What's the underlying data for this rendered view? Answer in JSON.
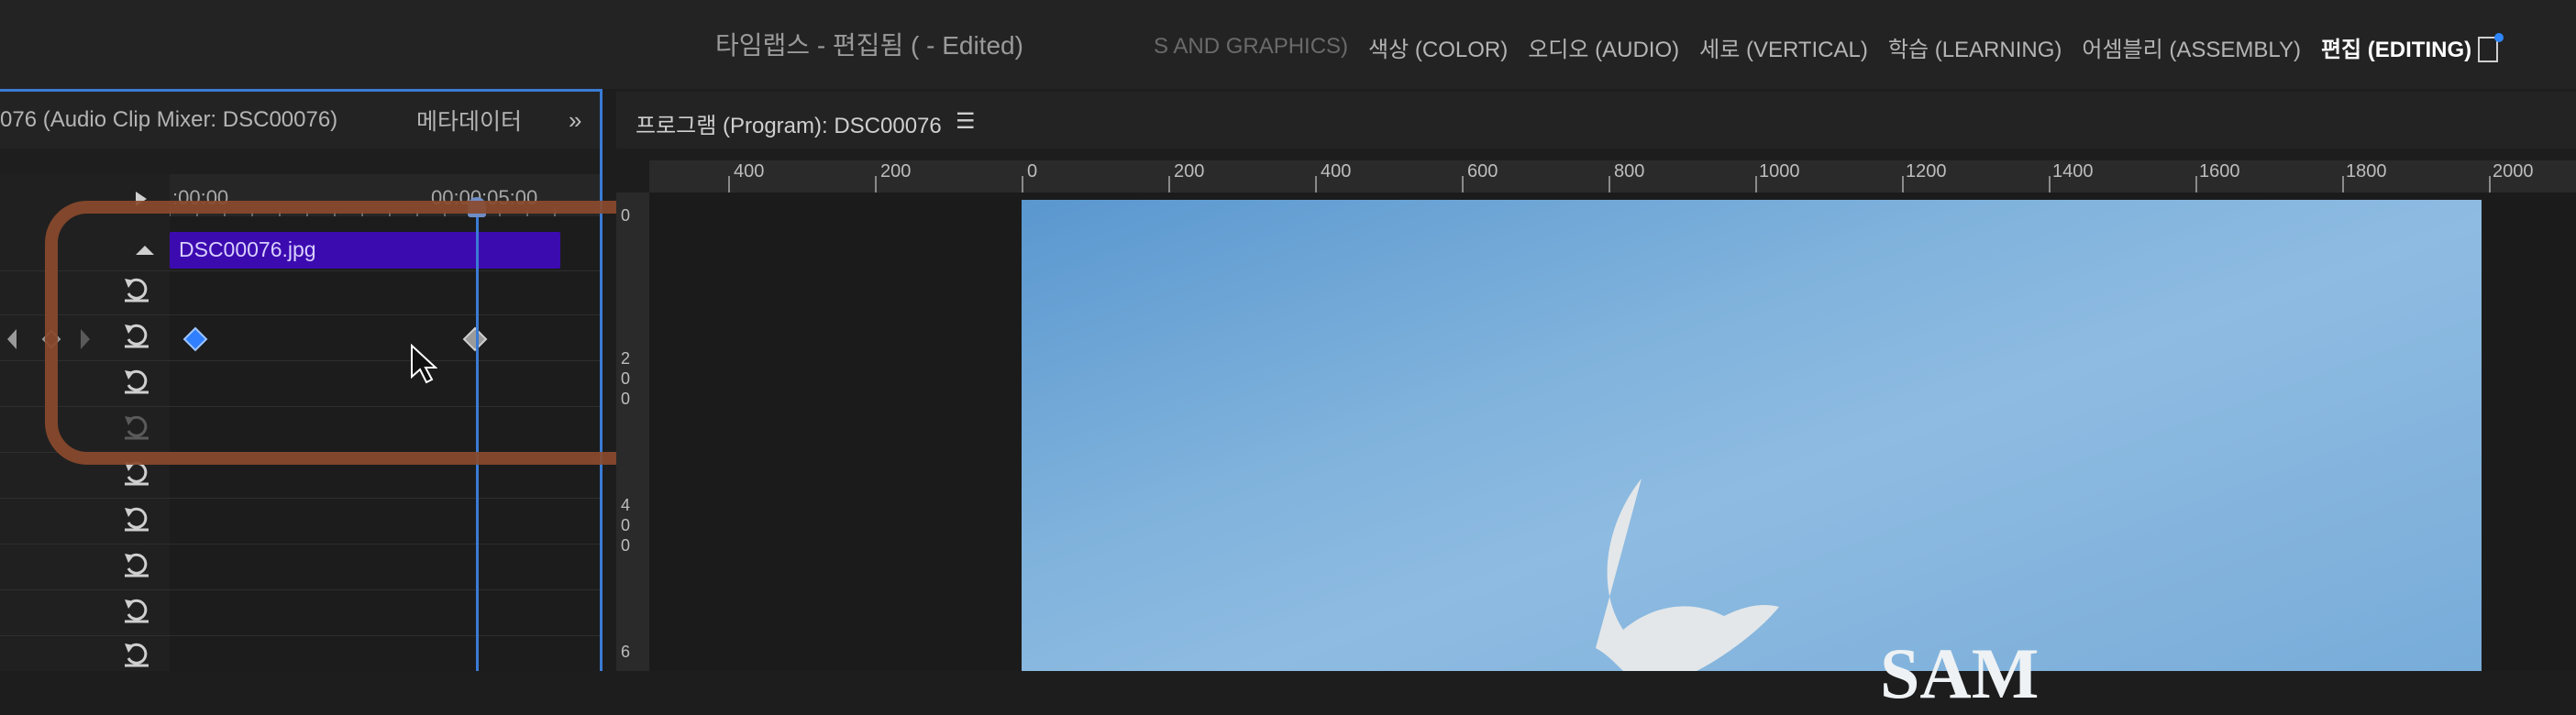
{
  "app": {
    "title": "타임랩스 - 편집됨 ( - Edited)"
  },
  "workspaces": [
    {
      "label": "S AND GRAPHICS)",
      "state": "fade"
    },
    {
      "label": "색상 (COLOR)",
      "state": "normal"
    },
    {
      "label": "오디오 (AUDIO)",
      "state": "normal"
    },
    {
      "label": "세로 (VERTICAL)",
      "state": "normal"
    },
    {
      "label": "학습 (LEARNING)",
      "state": "normal"
    },
    {
      "label": "어셈블리 (ASSEMBLY)",
      "state": "normal"
    },
    {
      "label": "편집 (EDITING)",
      "state": "active"
    }
  ],
  "left_panel": {
    "tab_audio_mixer": "076 (Audio Clip Mixer: DSC00076)",
    "tab_metadata": "메타데이터",
    "expand_glyph": "»",
    "timecode_start": ":00:00",
    "timecode_end": "00:00:05:00",
    "clip_name": "DSC00076.jpg"
  },
  "program": {
    "title": "프로그램 (Program): DSC00076",
    "menu_glyph": "☰",
    "h_ruler": [
      "400",
      "200",
      "0",
      "200",
      "400",
      "600",
      "800",
      "1000",
      "1200",
      "1400",
      "1600",
      "1800",
      "2000"
    ],
    "v_ruler": [
      "0",
      "200",
      "400",
      "6"
    ],
    "image_text": "SAM"
  },
  "colors": {
    "accent_blue": "#3a7bd5",
    "clip_purple": "#3c0bb0",
    "highlight": "#8a4a2c"
  }
}
